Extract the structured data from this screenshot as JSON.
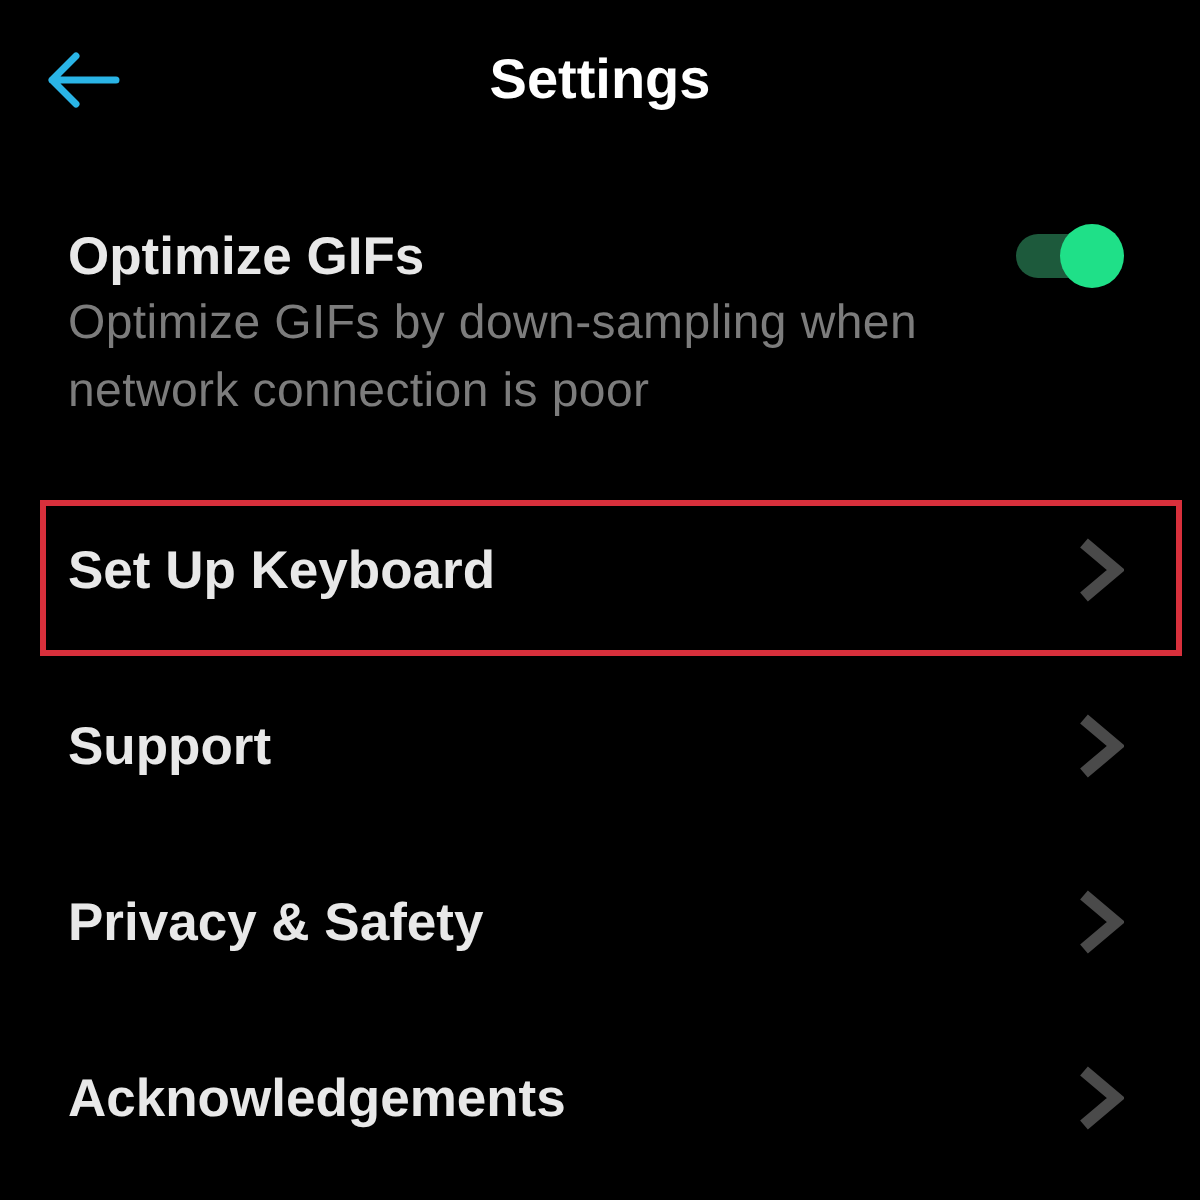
{
  "header": {
    "title": "Settings"
  },
  "toggle_setting": {
    "title": "Optimize GIFs",
    "description": "Optimize GIFs by down-sampling when network connection is poor",
    "on": true
  },
  "menu_items": [
    {
      "label": "Set Up Keyboard",
      "highlighted": true
    },
    {
      "label": "Support",
      "highlighted": false
    },
    {
      "label": "Privacy & Safety",
      "highlighted": false
    },
    {
      "label": "Acknowledgements",
      "highlighted": false
    }
  ]
}
